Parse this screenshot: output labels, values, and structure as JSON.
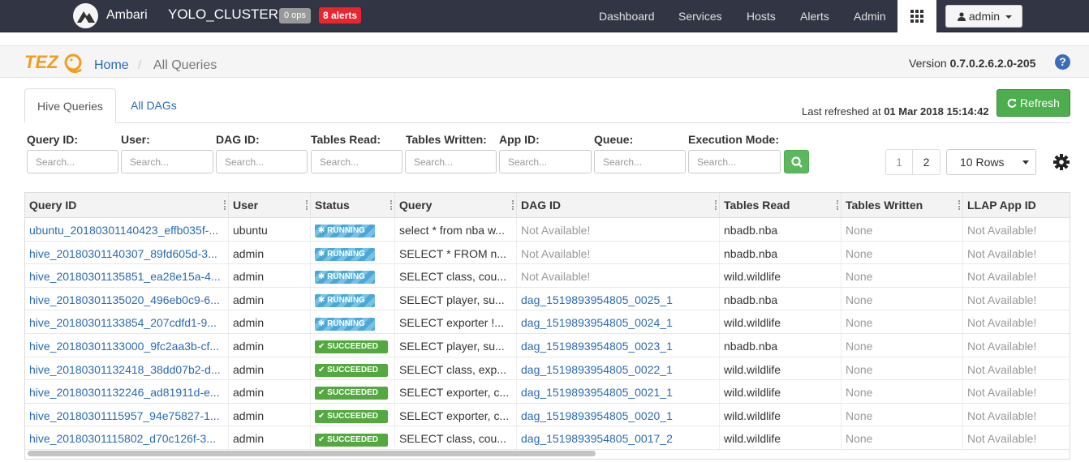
{
  "topnav": {
    "brand": "Ambari",
    "cluster": "YOLO_CLUSTER",
    "ops_badge": "0 ops",
    "alerts_badge": "8 alerts",
    "items": [
      {
        "label": "Dashboard"
      },
      {
        "label": "Services"
      },
      {
        "label": "Hosts"
      },
      {
        "label": "Alerts"
      },
      {
        "label": "Admin"
      }
    ],
    "user": "admin"
  },
  "tez": {
    "logo_text": "TEZ",
    "breadcrumb_home": "Home",
    "breadcrumb_sep": "/",
    "breadcrumb_current": "All Queries",
    "version_label": "Version",
    "version_value": "0.7.0.2.6.2.0-205"
  },
  "tabs": [
    {
      "label": "Hive Queries",
      "active": true
    },
    {
      "label": "All DAGs",
      "active": false
    }
  ],
  "last_refreshed_label": "Last refreshed at",
  "last_refreshed_value": "01 Mar 2018 15:14:42",
  "refresh_label": "Refresh",
  "filters": [
    {
      "label": "Query ID:",
      "placeholder": "Search..."
    },
    {
      "label": "User:",
      "placeholder": "Search..."
    },
    {
      "label": "DAG ID:",
      "placeholder": "Search..."
    },
    {
      "label": "Tables Read:",
      "placeholder": "Search..."
    },
    {
      "label": "Tables Written:",
      "placeholder": "Search..."
    },
    {
      "label": "App ID:",
      "placeholder": "Search..."
    },
    {
      "label": "Queue:",
      "placeholder": "Search..."
    },
    {
      "label": "Execution Mode:",
      "placeholder": "Search..."
    }
  ],
  "pagination": {
    "pages": [
      "1",
      "2"
    ],
    "rows_select": "10 Rows"
  },
  "table": {
    "columns": [
      "Query ID",
      "User",
      "Status",
      "Query",
      "DAG ID",
      "Tables Read",
      "Tables Written",
      "LLAP App ID"
    ],
    "rows": [
      {
        "query_id": "ubuntu_20180301140423_effb035f-...",
        "user": "ubuntu",
        "status": "RUNNING",
        "query": "select * from nba w...",
        "dag_id": "Not Available!",
        "tables_read": "nbadb.nba",
        "tables_written": "None",
        "llap": "Not Available!"
      },
      {
        "query_id": "hive_20180301140307_89fd605d-3...",
        "user": "admin",
        "status": "RUNNING",
        "query": "SELECT * FROM n...",
        "dag_id": "Not Available!",
        "tables_read": "nbadb.nba",
        "tables_written": "None",
        "llap": "Not Available!"
      },
      {
        "query_id": "hive_20180301135851_ea28e15a-4...",
        "user": "admin",
        "status": "RUNNING",
        "query": "SELECT class, cou...",
        "dag_id": "Not Available!",
        "tables_read": "wild.wildlife",
        "tables_written": "None",
        "llap": "Not Available!"
      },
      {
        "query_id": "hive_20180301135020_496eb0c9-6...",
        "user": "admin",
        "status": "RUNNING",
        "query": "SELECT player, su...",
        "dag_id": "dag_1519893954805_0025_1",
        "tables_read": "nbadb.nba",
        "tables_written": "None",
        "llap": "Not Available!"
      },
      {
        "query_id": "hive_20180301133854_207cdfd1-9...",
        "user": "admin",
        "status": "RUNNING",
        "query": "SELECT exporter !...",
        "dag_id": "dag_1519893954805_0024_1",
        "tables_read": "wild.wildlife",
        "tables_written": "None",
        "llap": "Not Available!"
      },
      {
        "query_id": "hive_20180301133000_9fc2aa3b-cf...",
        "user": "admin",
        "status": "SUCCEEDED",
        "query": "SELECT player, su...",
        "dag_id": "dag_1519893954805_0023_1",
        "tables_read": "nbadb.nba",
        "tables_written": "None",
        "llap": "Not Available!"
      },
      {
        "query_id": "hive_20180301132418_38dd07b2-d...",
        "user": "admin",
        "status": "SUCCEEDED",
        "query": "SELECT class, exp...",
        "dag_id": "dag_1519893954805_0022_1",
        "tables_read": "wild.wildlife",
        "tables_written": "None",
        "llap": "Not Available!"
      },
      {
        "query_id": "hive_20180301132246_ad81911d-e...",
        "user": "admin",
        "status": "SUCCEEDED",
        "query": "SELECT exporter, c...",
        "dag_id": "dag_1519893954805_0021_1",
        "tables_read": "wild.wildlife",
        "tables_written": "None",
        "llap": "Not Available!"
      },
      {
        "query_id": "hive_20180301115957_94e75827-1...",
        "user": "admin",
        "status": "SUCCEEDED",
        "query": "SELECT exporter, c...",
        "dag_id": "dag_1519893954805_0020_1",
        "tables_read": "wild.wildlife",
        "tables_written": "None",
        "llap": "Not Available!"
      },
      {
        "query_id": "hive_20180301115802_d70c126f-3...",
        "user": "admin",
        "status": "SUCCEEDED",
        "query": "SELECT class, cou...",
        "dag_id": "dag_1519893954805_0017_2",
        "tables_read": "wild.wildlife",
        "tables_written": "None",
        "llap": "Not Available!"
      }
    ]
  },
  "colors": {
    "topnav_bg": "#323544",
    "link": "#2a6ab4",
    "running": "#4aa7d6",
    "succeeded": "#53a93f",
    "alert_red": "#e9252f",
    "refresh_green": "#4cae4c"
  }
}
